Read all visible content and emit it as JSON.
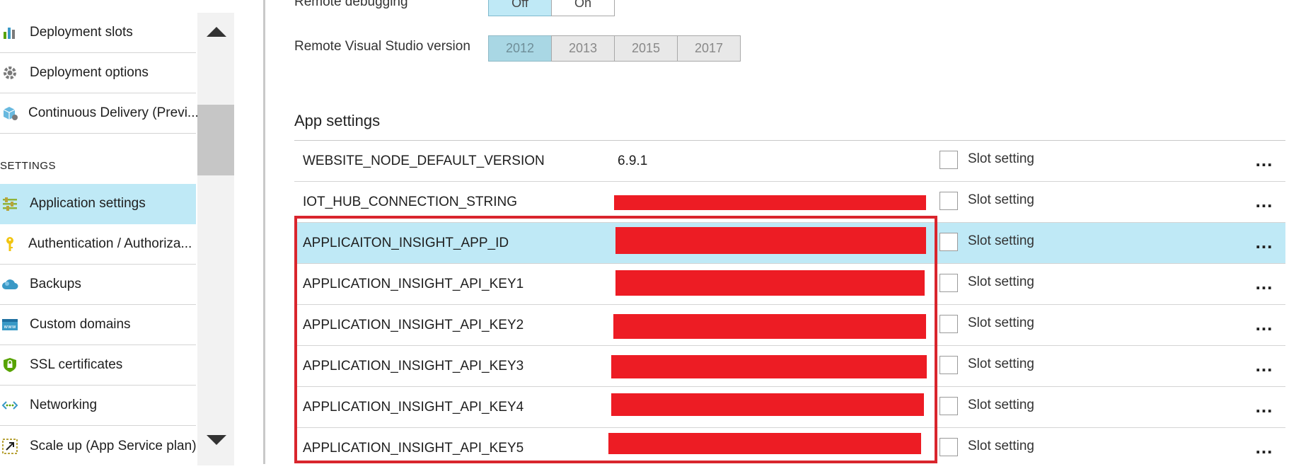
{
  "sidebar": {
    "items_top": [
      {
        "label": "Deployment slots",
        "icon": "deployment-slots-icon"
      },
      {
        "label": "Deployment options",
        "icon": "gear-icon"
      },
      {
        "label": "Continuous Delivery (Previ...",
        "icon": "package-icon"
      }
    ],
    "settings_heading": "SETTINGS",
    "items_settings": [
      {
        "label": "Application settings",
        "icon": "sliders-icon"
      },
      {
        "label": "Authentication / Authoriza...",
        "icon": "key-icon"
      },
      {
        "label": "Backups",
        "icon": "cloud-icon"
      },
      {
        "label": "Custom domains",
        "icon": "www-icon"
      },
      {
        "label": "SSL certificates",
        "icon": "shield-icon"
      },
      {
        "label": "Networking",
        "icon": "network-icon"
      },
      {
        "label": "Scale up (App Service plan)",
        "icon": "scale-up-icon"
      }
    ]
  },
  "debug": {
    "remote_debugging_label": "Remote debugging",
    "remote_debugging_options": [
      "Off",
      "On"
    ],
    "remote_debugging_selected": "Off",
    "vs_version_label": "Remote Visual Studio version",
    "vs_versions": [
      "2012",
      "2013",
      "2015",
      "2017"
    ],
    "vs_version_selected": "2012"
  },
  "app_settings": {
    "heading": "App settings",
    "slot_setting_label": "Slot setting",
    "rows": [
      {
        "name": "WEBSITE_NODE_DEFAULT_VERSION",
        "value": "6.9.1",
        "redacted": false
      },
      {
        "name": "IOT_HUB_CONNECTION_STRING",
        "value": "",
        "redacted": true
      },
      {
        "name": "APPLICAITON_INSIGHT_APP_ID",
        "value": "",
        "redacted": true
      },
      {
        "name": "APPLICATION_INSIGHT_API_KEY1",
        "value": "",
        "redacted": true
      },
      {
        "name": "APPLICATION_INSIGHT_API_KEY2",
        "value": "",
        "redacted": true
      },
      {
        "name": "APPLICATION_INSIGHT_API_KEY3",
        "value": "",
        "redacted": true
      },
      {
        "name": "APPLICATION_INSIGHT_API_KEY4",
        "value": "",
        "redacted": true
      },
      {
        "name": "APPLICATION_INSIGHT_API_KEY5",
        "value": "",
        "redacted": true
      }
    ]
  },
  "colors": {
    "selection": "#bfe9f6",
    "redaction": "#ed1c24",
    "highlight_border": "#d9252d"
  }
}
